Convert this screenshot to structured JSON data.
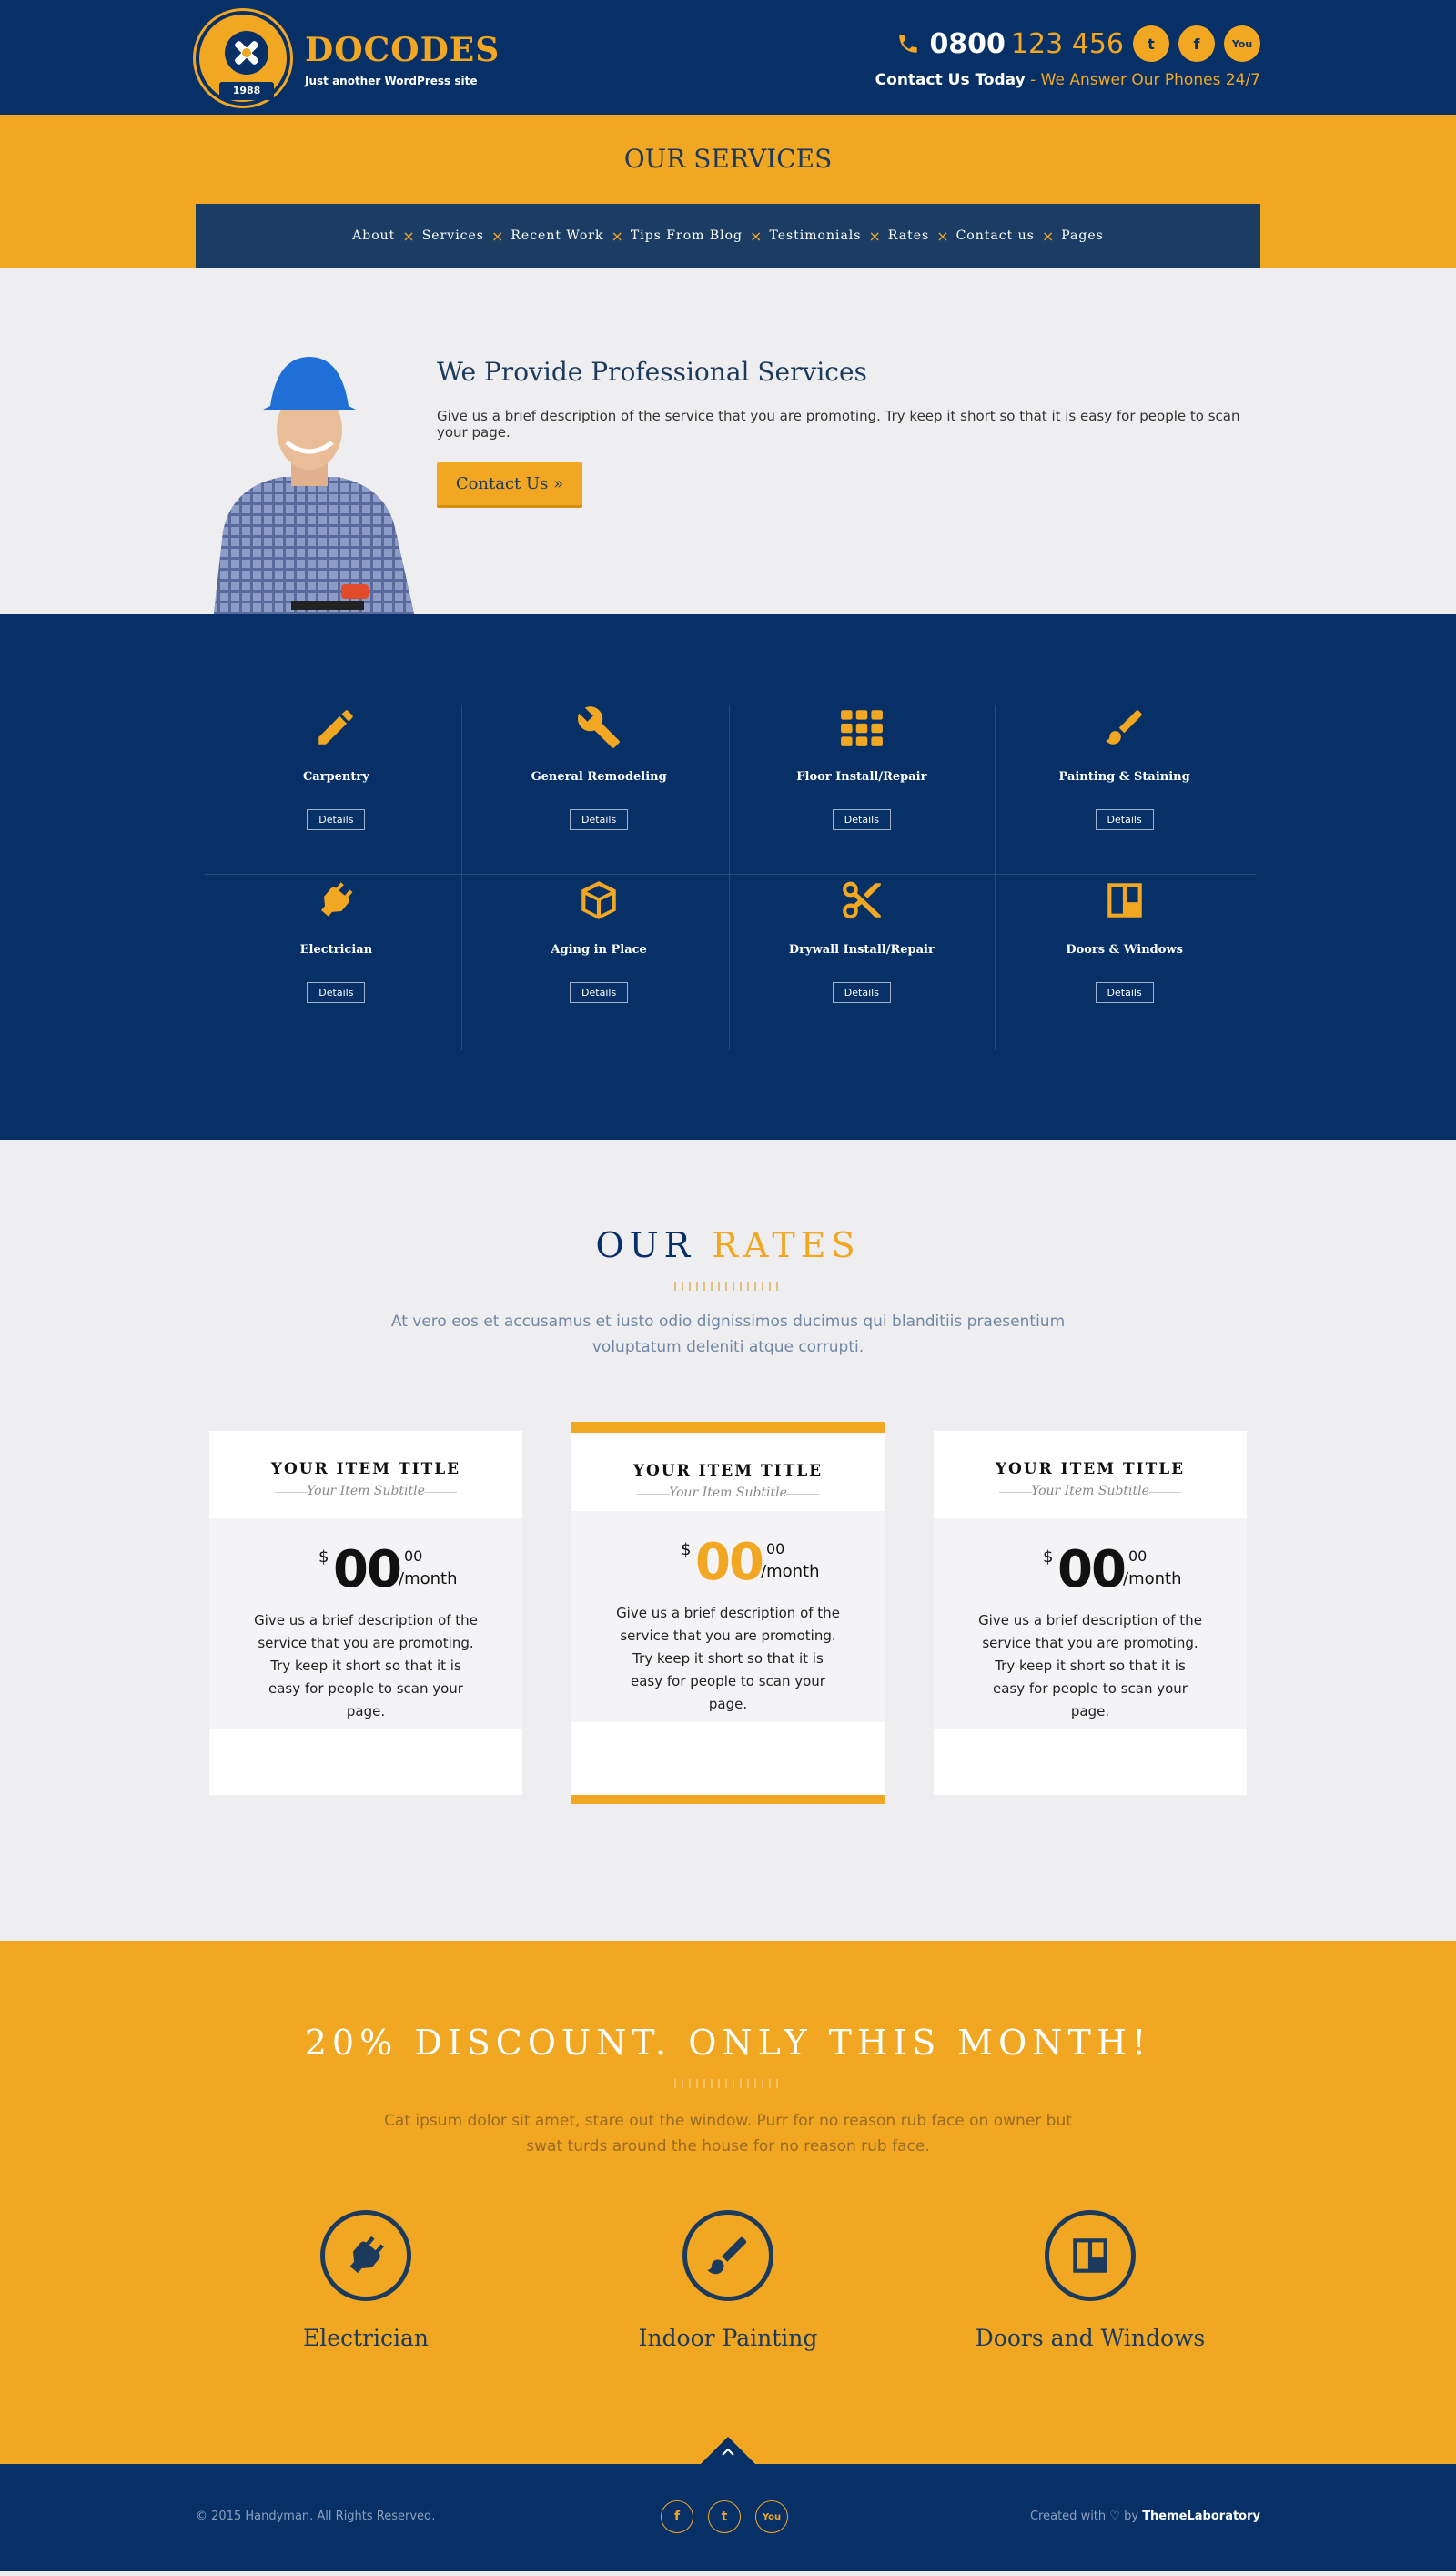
{
  "header": {
    "logo_year": "1988",
    "brand": "DOCODES",
    "tagline": "Just another WordPress site",
    "phone_bold": "0800",
    "phone_rest": "123 456",
    "contact_label": "Contact Us Today",
    "contact_sub": "- We Answer Our Phones 24/7",
    "social": [
      {
        "icon": "twitter-icon",
        "glyph": "t"
      },
      {
        "icon": "facebook-icon",
        "glyph": "f"
      },
      {
        "icon": "youtube-icon",
        "glyph": "You"
      }
    ]
  },
  "page_title": "OUR SERVICES",
  "nav": [
    "About",
    "Services",
    "Recent Work",
    "Tips From Blog",
    "Testimonials",
    "Rates",
    "Contact us",
    "Pages"
  ],
  "intro": {
    "heading": "We Provide Professional Services",
    "text": "Give us a brief description of the service that you are promoting. Try keep it short so that it is easy for people to scan your page.",
    "button": "Contact Us »"
  },
  "services": [
    {
      "name": "Carpentry",
      "icon": "pencil-icon",
      "button": "Details"
    },
    {
      "name": "General Remodeling",
      "icon": "wrench-icon",
      "button": "Details"
    },
    {
      "name": "Floor Install/Repair",
      "icon": "tiles-icon",
      "button": "Details"
    },
    {
      "name": "Painting & Staining",
      "icon": "brush-icon",
      "button": "Details"
    },
    {
      "name": "Electrician",
      "icon": "plug-icon",
      "button": "Details"
    },
    {
      "name": "Aging in Place",
      "icon": "box-icon",
      "button": "Details"
    },
    {
      "name": "Drywall Install/Repair",
      "icon": "scissors-icon",
      "button": "Details"
    },
    {
      "name": "Doors & Windows",
      "icon": "window-icon",
      "button": "Details"
    }
  ],
  "rates": {
    "title_a": "OUR",
    "title_b": "RATES",
    "text": "At vero eos et accusamus et iusto odio dignissimos ducimus qui blanditiis praesentium voluptatum deleniti atque corrupti.",
    "cards": [
      {
        "title": "YOUR ITEM TITLE",
        "subtitle": "Your Item Subtitle",
        "currency": "$",
        "amount": "00",
        "cents": "00",
        "period": "/month",
        "desc": "Give us a brief description of the service that you are promoting. Try keep it short so that it is easy for people to scan your page."
      },
      {
        "title": "YOUR ITEM TITLE",
        "subtitle": "Your Item Subtitle",
        "currency": "$",
        "amount": "00",
        "cents": "00",
        "period": "/month",
        "desc": "Give us a brief description of the service that you are promoting. Try keep it short so that it is easy for people to scan your page."
      },
      {
        "title": "YOUR ITEM TITLE",
        "subtitle": "Your Item Subtitle",
        "currency": "$",
        "amount": "00",
        "cents": "00",
        "period": "/month",
        "desc": "Give us a brief description of the service that you are promoting. Try keep it short so that it is easy for people to scan your page."
      }
    ]
  },
  "discount": {
    "title": "20% DISCOUNT. ONLY THIS MONTH!",
    "text": "Cat ipsum dolor sit amet, stare out the window. Purr for no reason rub face on owner but swat turds around the house for no reason rub face.",
    "items": [
      {
        "label": "Electrician",
        "icon": "plug-icon"
      },
      {
        "label": "Indoor Painting",
        "icon": "brush-icon"
      },
      {
        "label": "Doors and Windows",
        "icon": "window-icon"
      }
    ]
  },
  "footer": {
    "copyright": "© 2015 Handyman. All Rights Reserved.",
    "credit_prefix": "Created with",
    "credit_by": "by",
    "credit_name": "ThemeLaboratory"
  },
  "colors": {
    "navy": "#063066",
    "accent": "#f1a722",
    "light_bg": "#eeedef"
  }
}
